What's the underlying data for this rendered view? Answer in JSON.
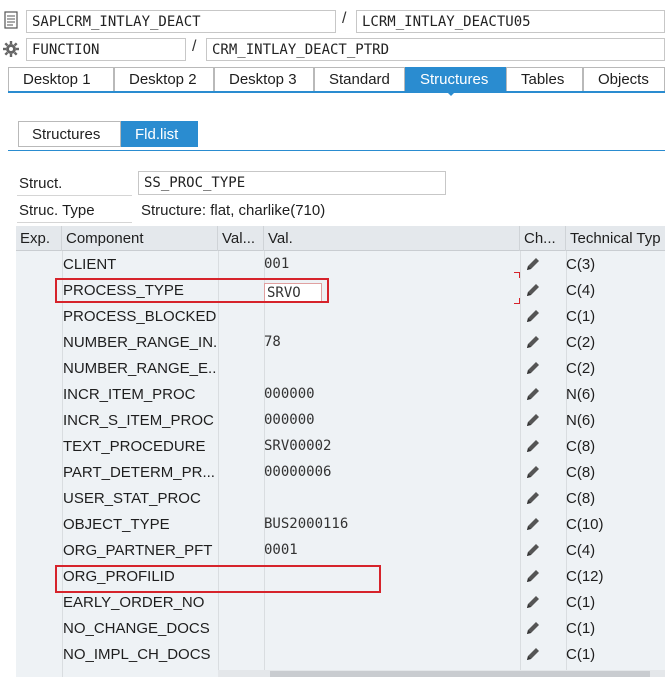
{
  "header": {
    "row1": {
      "left_field": "SAPLCRM_INTLAY_DEACT",
      "right_field": "LCRM_INTLAY_DEACTU05"
    },
    "row2": {
      "left_field": "FUNCTION",
      "right_field": "CRM_INTLAY_DEACT_PTRD"
    },
    "separator": "/"
  },
  "main_tabs": [
    "Desktop 1",
    "Desktop 2",
    "Desktop 3",
    "Standard",
    "Structures",
    "Tables",
    "Objects"
  ],
  "active_main_tab": "Structures",
  "sub_tabs": [
    "Structures",
    "Fld.list"
  ],
  "active_sub_tab": "Fld.list",
  "struct": {
    "struct_label": "Struct.",
    "struct_value": "SS_PROC_TYPE",
    "type_label": "Struc. Type",
    "type_value": "Structure: flat, charlike(710)"
  },
  "grid": {
    "columns": [
      "Exp.",
      "Component",
      "Val...",
      "Val.",
      "Ch...",
      "Technical Typ"
    ],
    "rows": [
      {
        "component": "CLIENT",
        "value": "001",
        "tech": "C(3)"
      },
      {
        "component": "PROCESS_TYPE",
        "value": "SRVO",
        "tech": "C(4)"
      },
      {
        "component": "PROCESS_BLOCKED",
        "value": "",
        "tech": "C(1)"
      },
      {
        "component": "NUMBER_RANGE_IN...",
        "value": "78",
        "tech": "C(2)"
      },
      {
        "component": "NUMBER_RANGE_E...",
        "value": "",
        "tech": "C(2)"
      },
      {
        "component": "INCR_ITEM_PROC",
        "value": "000000",
        "tech": "N(6)"
      },
      {
        "component": "INCR_S_ITEM_PROC",
        "value": "000000",
        "tech": "N(6)"
      },
      {
        "component": "TEXT_PROCEDURE",
        "value": "SRV00002",
        "tech": "C(8)"
      },
      {
        "component": "PART_DETERM_PR...",
        "value": "00000006",
        "tech": "C(8)"
      },
      {
        "component": "USER_STAT_PROC",
        "value": "",
        "tech": "C(8)"
      },
      {
        "component": "OBJECT_TYPE",
        "value": "BUS2000116",
        "tech": "C(10)"
      },
      {
        "component": "ORG_PARTNER_PFT",
        "value": "0001",
        "tech": "C(4)"
      },
      {
        "component": "ORG_PROFILID",
        "value": "",
        "tech": "C(12)"
      },
      {
        "component": "EARLY_ORDER_NO",
        "value": "",
        "tech": "C(1)"
      },
      {
        "component": "NO_CHANGE_DOCS",
        "value": "",
        "tech": "C(1)"
      },
      {
        "component": "NO_IMPL_CH_DOCS",
        "value": "",
        "tech": "C(1)"
      }
    ]
  },
  "icons": {
    "row1": "document-icon",
    "row2": "gear-icon",
    "change": "pencil-icon"
  },
  "colors": {
    "accent": "#2a8cd0",
    "highlight": "#d6232b"
  }
}
